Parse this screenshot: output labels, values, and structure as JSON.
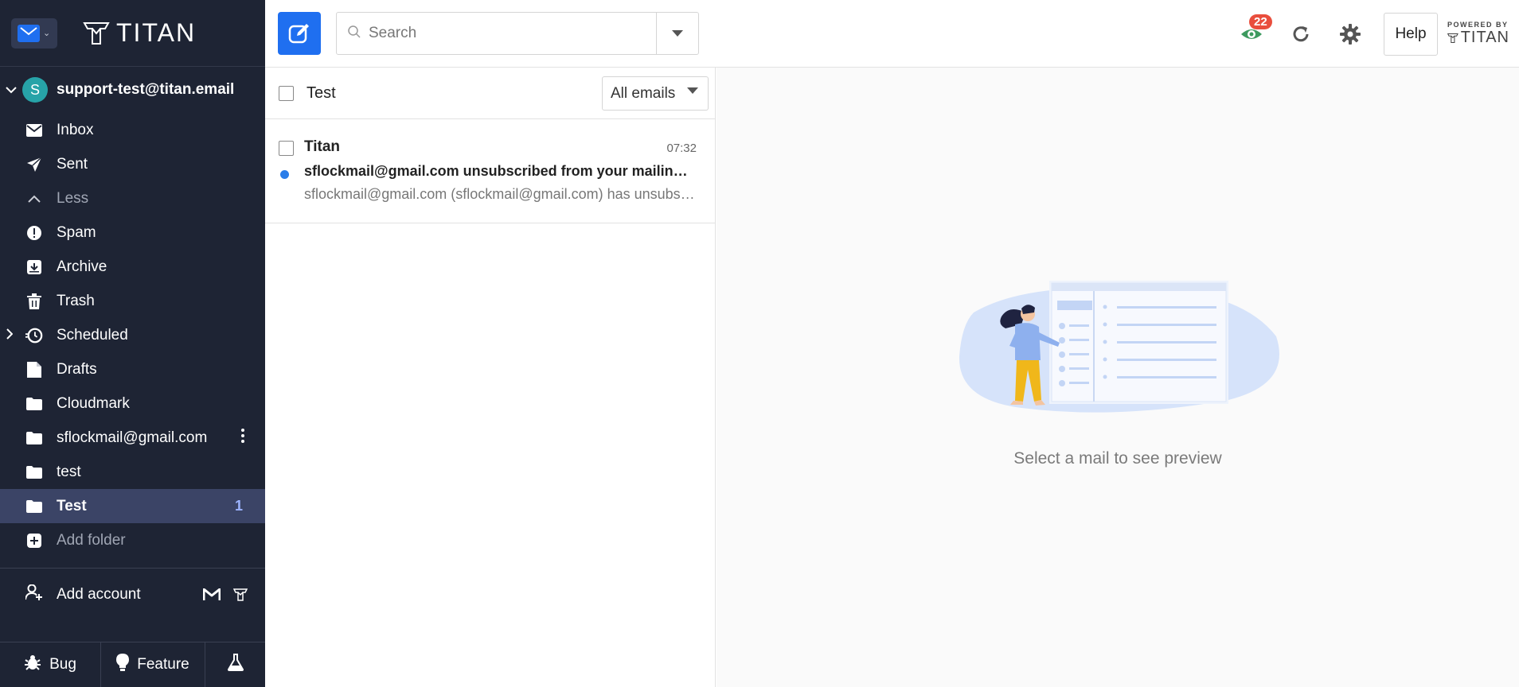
{
  "brand": {
    "logo_text": "TITAN"
  },
  "account": {
    "avatar_initial": "S",
    "email": "support-test@titan.email"
  },
  "folders": [
    {
      "key": "inbox",
      "label": "Inbox"
    },
    {
      "key": "sent",
      "label": "Sent"
    },
    {
      "key": "less",
      "label": "Less"
    },
    {
      "key": "spam",
      "label": "Spam"
    },
    {
      "key": "archive",
      "label": "Archive"
    },
    {
      "key": "trash",
      "label": "Trash"
    },
    {
      "key": "scheduled",
      "label": "Scheduled"
    },
    {
      "key": "drafts",
      "label": "Drafts"
    },
    {
      "key": "cloudmark",
      "label": "Cloudmark"
    },
    {
      "key": "sflockmail",
      "label": "sflockmail@gmail.com"
    },
    {
      "key": "test-lower",
      "label": "test"
    },
    {
      "key": "test-upper",
      "label": "Test",
      "count": "1"
    },
    {
      "key": "add-folder",
      "label": "Add folder"
    }
  ],
  "add_account": {
    "label": "Add account"
  },
  "bottom": {
    "bug_label": "Bug",
    "feature_label": "Feature"
  },
  "topbar": {
    "search_placeholder": "Search",
    "notification_count": "22",
    "help_label": "Help",
    "powered_by": "POWERED BY",
    "powered_brand": "TITAN"
  },
  "list": {
    "folder_title": "Test",
    "filter_label": "All emails",
    "emails": [
      {
        "sender": "Titan",
        "time": "07:32",
        "subject": "sflockmail@gmail.com unsubscribed from your mailing list",
        "snippet": "sflockmail@gmail.com (sflockmail@gmail.com) has unsubscribed from your mailing list"
      }
    ]
  },
  "preview": {
    "empty_text": "Select a mail to see preview"
  },
  "colors": {
    "sidebar_bg": "#1e2434",
    "accent": "#1f6ff0",
    "active_folder": "#3b4466",
    "badge": "#e94e3d"
  }
}
